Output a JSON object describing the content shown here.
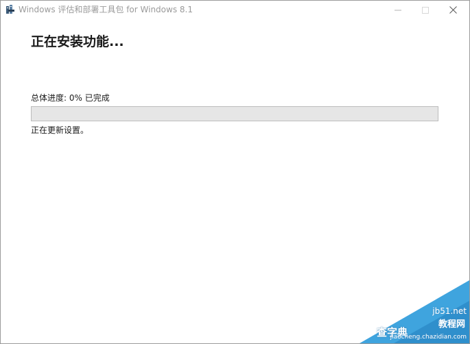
{
  "window": {
    "title": "Windows 评估和部署工具包 for Windows 8.1"
  },
  "main": {
    "heading": "正在安装功能...",
    "progress_label": "总体进度: 0% 已完成",
    "progress_percent": 0,
    "status": "正在更新设置。"
  },
  "watermark": {
    "site": "jb51.net",
    "brand": "教程网",
    "left_text": "查字典",
    "url": "jiaocheng.chazidian.com"
  },
  "colors": {
    "progress_track": "#e6e6e6",
    "progress_fill": "#06b025",
    "watermark_blue": "#3fa4de"
  },
  "icons": {
    "app": "installer-icon",
    "minimize": "minimize-icon",
    "maximize": "maximize-icon",
    "close": "close-icon"
  }
}
